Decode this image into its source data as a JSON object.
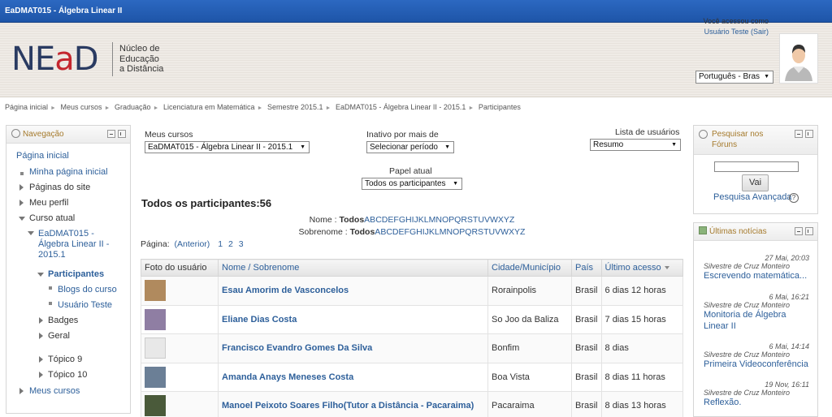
{
  "window": {
    "title": "EaDMAT015 - Álgebra Linear II"
  },
  "header": {
    "logo_text_a": "NE",
    "logo_text_b": "a",
    "logo_text_c": "D",
    "logo_desc_1": "Núcleo de",
    "logo_desc_2": "Educação",
    "logo_desc_3": "a Distância",
    "access_text": "Você acessou como",
    "user_name": "Usuário Teste",
    "logout": "(Sair)",
    "language": "Português - Bras"
  },
  "breadcrumb": [
    "Página inicial",
    "Meus cursos",
    "Graduação",
    "Licenciatura em Matemática",
    "Semestre 2015.1",
    "EaDMAT015 - Álgebra Linear II - 2015.1",
    "Participantes"
  ],
  "navigation": {
    "title": "Navegação",
    "items": {
      "home": "Página inicial",
      "my_home": "Minha página inicial",
      "site_pages": "Páginas do site",
      "profile": "Meu perfil",
      "current_course": "Curso atual",
      "course_name_1": "EaDMAT015 -",
      "course_name_2": "Álgebra Linear II -",
      "course_name_3": "2015.1",
      "participants": "Participantes",
      "course_blogs": "Blogs do curso",
      "test_user": "Usuário Teste",
      "badges": "Badges",
      "general": "Geral",
      "topic9": "Tópico 9",
      "topic10": "Tópico 10",
      "my_courses": "Meus cursos"
    }
  },
  "filters": {
    "my_courses_label": "Meus cursos",
    "my_courses_value": "EaDMAT015 - Álgebra Linear II - 2015.1",
    "inactive_label": "Inativo por mais de",
    "inactive_value": "Selecionar período",
    "user_list_label": "Lista de usuários",
    "user_list_value": "Resumo",
    "role_label": "Papel atual",
    "role_value": "Todos os participantes"
  },
  "participants": {
    "heading": "Todos os participantes:56",
    "name_label": "Nome :",
    "surname_label": "Sobrenome :",
    "all": "Todos",
    "letters": [
      "A",
      "B",
      "C",
      "D",
      "E",
      "F",
      "G",
      "H",
      "I",
      "J",
      "K",
      "L",
      "M",
      "N",
      "O",
      "P",
      "Q",
      "R",
      "S",
      "T",
      "U",
      "V",
      "W",
      "X",
      "Y",
      "Z"
    ],
    "page_label": "Página:",
    "prev": "(Anterior)",
    "pages": [
      "1",
      "2",
      "3"
    ]
  },
  "table": {
    "columns": [
      "Foto do usuário",
      "Nome / Sobrenome",
      "Cidade/Município",
      "País",
      "Último acesso"
    ],
    "rows": [
      {
        "name": "Esau Amorim de Vasconcelos",
        "city": "Rorainpolis",
        "country": "Brasil",
        "last": "6 dias 12 horas",
        "photo": "#b08a5e"
      },
      {
        "name": "Eliane Dias Costa",
        "city": "So Joo da Baliza",
        "country": "Brasil",
        "last": "7 dias 15 horas",
        "photo": "#8f7ea3"
      },
      {
        "name": "Francisco Evandro Gomes Da Silva",
        "city": "Bonfim",
        "country": "Brasil",
        "last": "8 dias",
        "photo": "#e8e8e8"
      },
      {
        "name": "Amanda Anays Meneses Costa",
        "city": "Boa Vista",
        "country": "Brasil",
        "last": "8 dias 11 horas",
        "photo": "#6b7f96"
      },
      {
        "name": "Manoel Peixoto Soares Filho(Tutor a Distância - Pacaraima)",
        "city": "Pacaraima",
        "country": "Brasil",
        "last": "8 dias 13 horas",
        "photo": "#4a5a3a"
      }
    ]
  },
  "search_block": {
    "title_1": "Pesquisar nos",
    "title_2": "Fóruns",
    "button": "Vai",
    "advanced": "Pesquisa Avançada",
    "input_value": ""
  },
  "news_block": {
    "title": "Últimas notícias",
    "items": [
      {
        "date": "27 Mai, 20:03",
        "author": "Silvestre de Cruz Monteiro",
        "link": "Escrevendo matemática..."
      },
      {
        "date": "6 Mai, 16:21",
        "author": "Silvestre de Cruz Monteiro",
        "link_1": "Monitoria de Álgebra",
        "link_2": "Linear II"
      },
      {
        "date": "6 Mai, 14:14",
        "author": "Silvestre de Cruz Monteiro",
        "link": "Primeira Videoconferência"
      },
      {
        "date": "19 Nov, 16:11",
        "author": "Silvestre de Cruz Monteiro",
        "link": "Reflexão."
      }
    ]
  },
  "colors": {
    "topbar": "#2c68c1",
    "link": "#2d5f9a",
    "logo_blue": "#2a3b62",
    "logo_red": "#c4262e",
    "block_title": "#a57a2c"
  }
}
